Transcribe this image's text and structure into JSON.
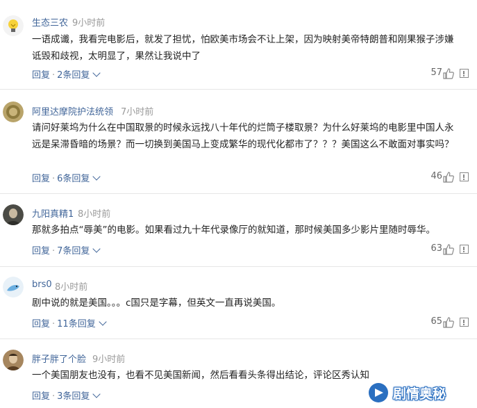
{
  "comments": [
    {
      "username": "生态三农",
      "time": "9小时前",
      "text": "一语成谶，我看完电影后，就发了担忧，怕欧美市场会不让上架，因为映射美帝特朗普和刚果猴子涉嫌诋毁和歧视，太明显了，果然让我说中了",
      "reply_label": "回复",
      "replies_label": "2条回复",
      "likes": "57"
    },
    {
      "username": "阿里达摩院护法统领",
      "time": "7小时前",
      "text": "请问好莱坞为什么在中国取景的时候永远找八十年代的烂筒子楼取景？为什么好莱坞的电影里中国人永远是呆滞昏暗的场景？而一切换到美国马上变成繁华的现代化都市了？？？美国这么不敢面对事实吗？",
      "reply_label": "回复",
      "replies_label": "6条回复",
      "likes": "46"
    },
    {
      "username": "九阳真精1",
      "time": "8小时前",
      "text": "那就多拍点“辱美”的电影。如果看过九十年代录像厅的就知道，那时候美国多少影片里随时辱华。",
      "reply_label": "回复",
      "replies_label": "7条回复",
      "likes": "63"
    },
    {
      "username": "brs0",
      "time": "8小时前",
      "text": "剧中说的就是美国。。。c国只是字幕，但英文一直再说美国。",
      "reply_label": "回复",
      "replies_label": "11条回复",
      "likes": "65"
    },
    {
      "username": "胖子胖了个脸",
      "time": "9小时前",
      "text": "一个美国朋友也没有，也看不见美国新闻，然后看看头条得出结论，评论区秀认知",
      "reply_label": "回复",
      "replies_label": "3条回复",
      "likes": ""
    }
  ],
  "watermark": {
    "text": "剧情奥秘"
  },
  "icons": [
    "lightbulb-avatar",
    "coin-avatar",
    "portrait-avatar",
    "bird-avatar",
    "man-avatar",
    "thumbs-up-icon",
    "report-icon"
  ],
  "colors": {
    "link": "#406599",
    "muted": "#999999",
    "text": "#222222",
    "watermark": "#2a6fc0"
  }
}
